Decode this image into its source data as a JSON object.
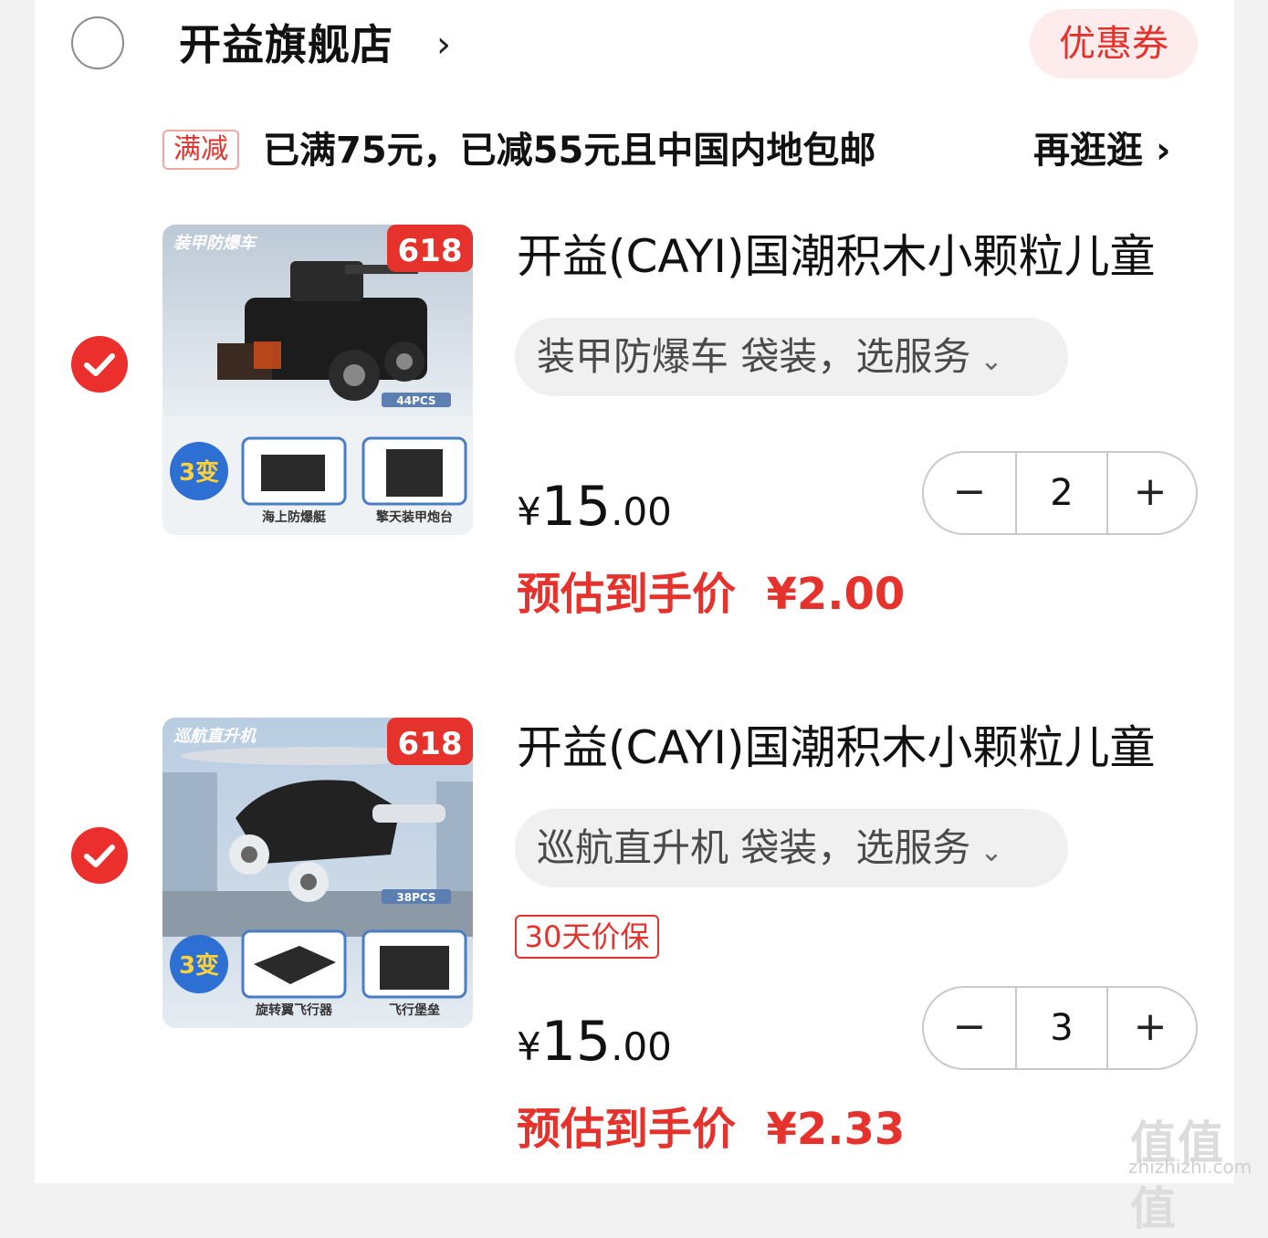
{
  "store": {
    "name": "开益旗舰店",
    "chevron": "›",
    "coupon_label": "优惠券"
  },
  "promo": {
    "tag": "满减",
    "text": "已满75元，已减55元且中国内地包邮",
    "more_label": "再逛逛",
    "more_chevron": "›"
  },
  "items": [
    {
      "title": "开益(CAYI)国潮积木小颗粒儿童",
      "sku": "装甲防爆车 袋装，选服务",
      "sku_chevron": "⌄",
      "price_currency": "¥",
      "price_int": "15",
      "price_dec": ".00",
      "estimated_label": "预估到手价",
      "estimated_price": "¥2.00",
      "quantity": "2",
      "minus": "−",
      "plus": "+",
      "image": {
        "caption_top": "装甲防爆车",
        "badge": "618",
        "pcs": "44PCS",
        "variant_badge": "3变",
        "sub1": "海上防爆艇",
        "sub2": "擎天装甲炮台"
      }
    },
    {
      "title": "开益(CAYI)国潮积木小颗粒儿童",
      "sku": "巡航直升机 袋装，选服务",
      "sku_chevron": "⌄",
      "badge": "30天价保",
      "price_currency": "¥",
      "price_int": "15",
      "price_dec": ".00",
      "estimated_label": "预估到手价",
      "estimated_price": "¥2.33",
      "quantity": "3",
      "minus": "−",
      "plus": "+",
      "image": {
        "caption_top": "巡航直升机",
        "badge": "618",
        "pcs": "38PCS",
        "variant_badge": "3变",
        "sub1": "旋转翼飞行器",
        "sub2": "飞行堡垒"
      }
    }
  ],
  "watermark": {
    "text": "值值值",
    "sub": "zhizhizhi.com"
  },
  "colors": {
    "accent": "#e6322c",
    "check": "#ea2f2c",
    "pill_bg": "#f0f0f0",
    "coupon_bg": "#fdeceb"
  }
}
